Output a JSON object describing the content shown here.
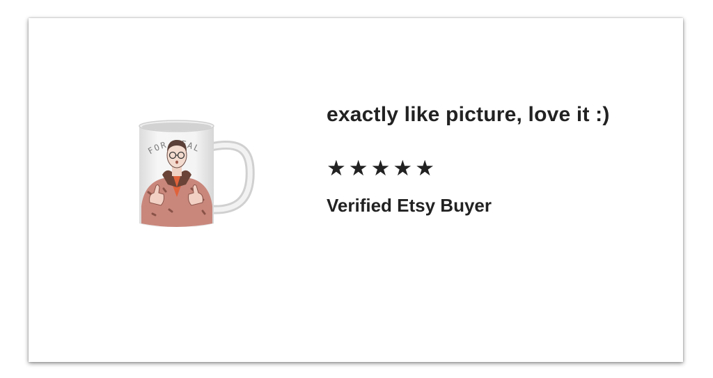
{
  "review": {
    "text": "exactly like picture, love it :)",
    "rating": 5,
    "rating_max": 5,
    "stars": [
      "★",
      "★",
      "★",
      "★",
      "★"
    ],
    "reviewer": "Verified Etsy Buyer"
  },
  "product": {
    "image_text": "FOR REAL",
    "icon": "coffee-mug-image"
  },
  "colors": {
    "text": "#222222",
    "card_background": "#ffffff",
    "star": "#222222"
  }
}
